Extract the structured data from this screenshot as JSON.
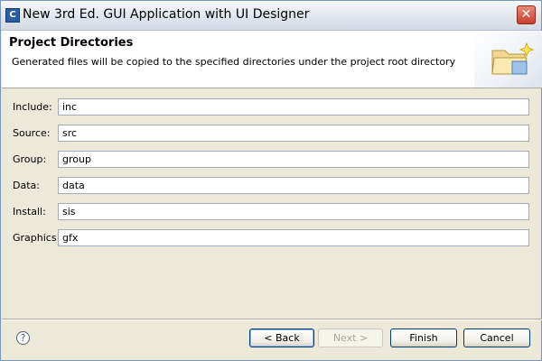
{
  "window": {
    "title": "New 3rd Ed. GUI Application with UI Designer",
    "app_icon_glyph": "C",
    "close_glyph": "✕"
  },
  "banner": {
    "title": "Project Directories",
    "description": "Generated files will be copied to the specified directories under the project root directory",
    "image_icon": "folder-sparkle-icon"
  },
  "fields": [
    {
      "label": "Include:",
      "value": "inc"
    },
    {
      "label": "Source:",
      "value": "src"
    },
    {
      "label": "Group:",
      "value": "group"
    },
    {
      "label": "Data:",
      "value": "data"
    },
    {
      "label": "Install:",
      "value": "sis"
    },
    {
      "label": "Graphics:",
      "value": "gfx"
    }
  ],
  "footer": {
    "help_glyph": "?",
    "back_label": "< Back",
    "next_label": "Next >",
    "finish_label": "Finish",
    "cancel_label": "Cancel"
  },
  "colors": {
    "title_text": "#000000",
    "close_button": "#c5402a",
    "banner_background": "#ffffff",
    "dialog_background": "#ece9d8"
  }
}
